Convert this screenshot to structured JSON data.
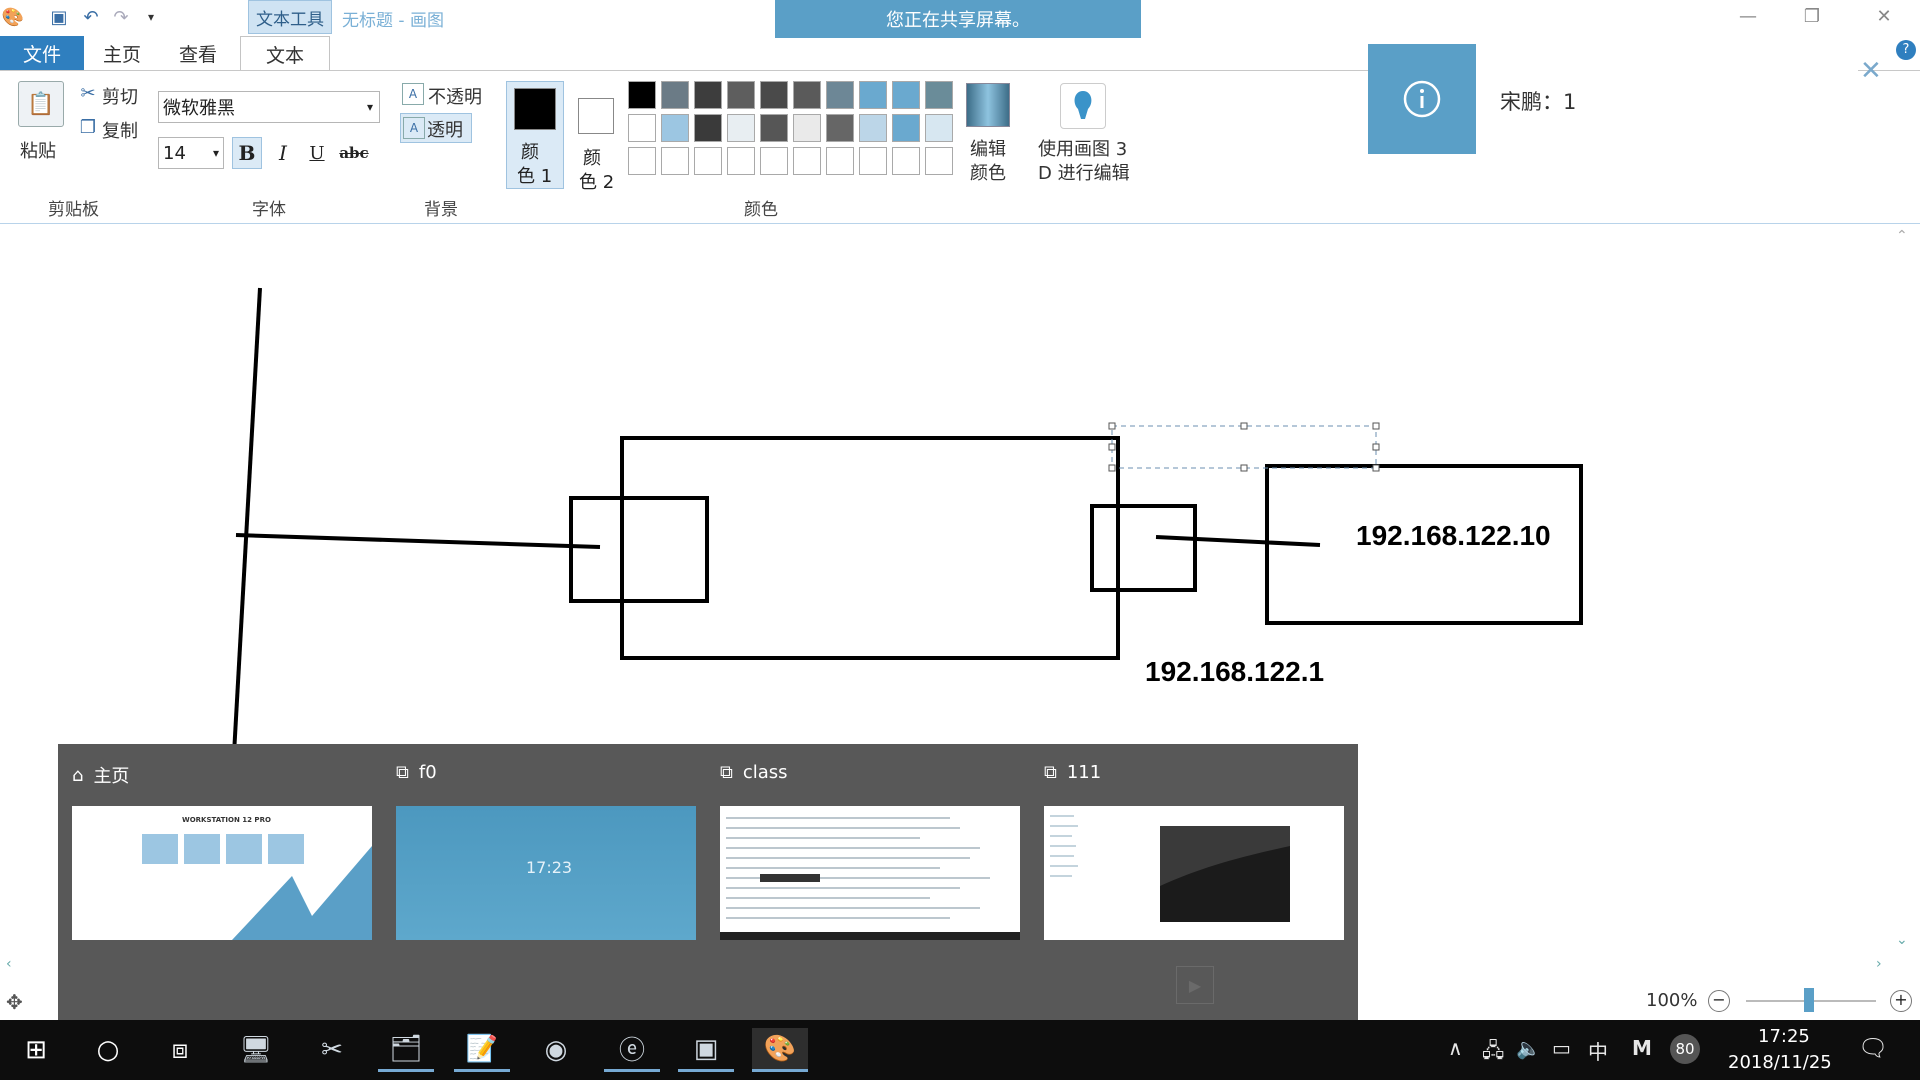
{
  "titlebar": {
    "context_tab": "文本工具",
    "doc_title": "无标题 - 画图",
    "share_banner": "您正在共享屏幕。"
  },
  "tabs": [
    {
      "label": "文件"
    },
    {
      "label": "主页"
    },
    {
      "label": "查看"
    },
    {
      "label": "文本"
    }
  ],
  "ribbon": {
    "clipboard": {
      "paste": "粘贴",
      "cut": "剪切",
      "copy": "复制",
      "group": "剪贴板"
    },
    "font": {
      "name": "微软雅黑",
      "size": "14",
      "bold": "B",
      "italic": "I",
      "underline": "U",
      "strike": "abc",
      "group": "字体"
    },
    "background": {
      "opaque": "不透明",
      "transparent": "透明",
      "group": "背景"
    },
    "colors": {
      "color1_line1": "颜",
      "color1_line2": "色 1",
      "color2_line1": "颜",
      "color2_line2": "色 2",
      "edit_line1": "编辑",
      "edit_line2": "颜色",
      "paint3d_line1": "使用画图 3",
      "paint3d_line2": "D 进行编辑",
      "group": "颜色",
      "color1_value": "#000000",
      "color2_value": "#ffffff",
      "palette_row1": [
        "#000000",
        "#6b7b86",
        "#3d3d3d",
        "#5e5e5e",
        "#4a4a4a",
        "#5a5a5a",
        "#6d8796",
        "#6aa9cf",
        "#6aa9cf",
        "#6a8c99"
      ],
      "palette_row2": [
        "#ffffff",
        "#9cc6e2",
        "#3a3a3a",
        "#e8eef2",
        "#565656",
        "#eaeaea",
        "#666666",
        "#bcd6e8",
        "#6aa9cf",
        "#d7e7f1"
      ],
      "palette_row3": [
        "#ffffff",
        "#ffffff",
        "#ffffff",
        "#ffffff",
        "#ffffff",
        "#ffffff",
        "#ffffff",
        "#ffffff",
        "#ffffff",
        "#ffffff"
      ]
    }
  },
  "notification": {
    "text": "宋鹏：1"
  },
  "canvas": {
    "ip_right": "192.168.122.10",
    "ip_bottom": "192.168.122.1"
  },
  "taskview": {
    "items": [
      {
        "label": "主页",
        "icon": "home-icon"
      },
      {
        "label": "f0",
        "icon": "vm-icon"
      },
      {
        "label": "class",
        "icon": "vm-icon"
      },
      {
        "label": "111",
        "icon": "vm-icon"
      }
    ],
    "thumb1_caption": "WORKSTATION 12 PRO",
    "thumb2_time": "17:23"
  },
  "statusbar": {
    "zoom": "100%"
  },
  "taskbar": {
    "tray_ime": "中",
    "tray_m": "M",
    "tray_badge": "80",
    "time": "17:25",
    "date": "2018/11/25"
  }
}
